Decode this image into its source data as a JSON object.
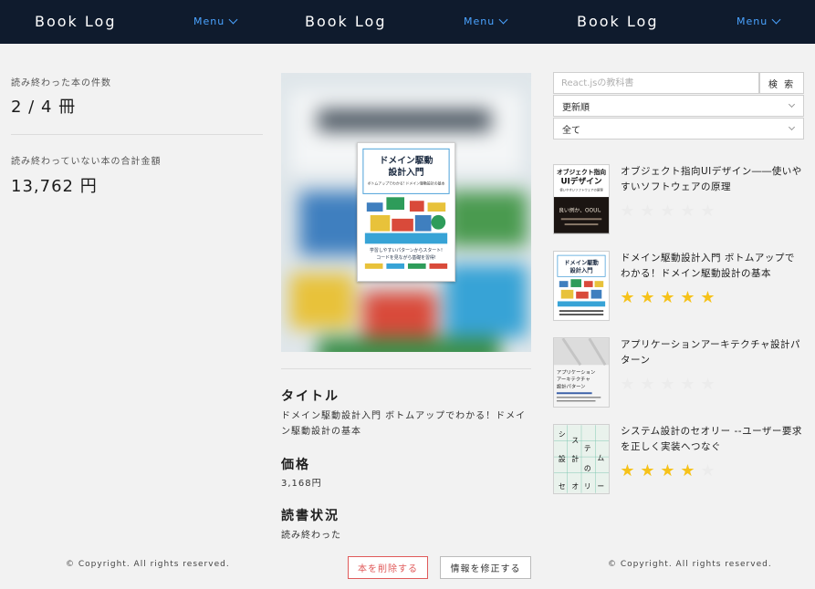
{
  "header": {
    "logos": [
      "Book Log",
      "Book Log",
      "Book Log"
    ],
    "menus": [
      "Menu",
      "Menu",
      "Menu"
    ]
  },
  "stats": {
    "read_count_label": "読み終わった本の件数",
    "read_count_value": "2 / 4 冊",
    "unread_total_label": "読み終わっていない本の合計金額",
    "unread_total_value": "13,762 円"
  },
  "detail": {
    "cover_text": {
      "title_line1": "ドメイン駆動",
      "title_line2": "設計入門",
      "subtitle": "ボトムアップでわかる! ドメイン駆動設計の基本",
      "blurb_line1": "学習しやすいパターンからスタート!",
      "blurb_line2": "コードを見ながら基礎を習得!"
    },
    "title_heading": "タイトル",
    "title_value": "ドメイン駆動設計入門 ボトムアップでわかる！ドメイン駆動設計の基本",
    "price_heading": "価格",
    "price_value": "3,168円",
    "status_heading": "読書状況",
    "status_value": "読み終わった",
    "delete_label": "本を削除する",
    "edit_label": "情報を修正する"
  },
  "footer": {
    "copyright_left": "© Copyright. All rights reserved.",
    "copyright_right": "© Copyright. All rights reserved."
  },
  "sidebar": {
    "search_placeholder": "React.jsの教科書",
    "search_button": "検 索",
    "sort_selected": "更新順",
    "filter_selected": "全て",
    "books": [
      {
        "title": "オブジェクト指向UIデザイン――使いやすいソフトウェアの原理",
        "rating": 0,
        "thumb": {
          "t1": "オブジェクト指向",
          "t2": "UIデザイン",
          "t3": "使いやすいソフトウェアの原理",
          "t4": "良い例か、OOUI。"
        }
      },
      {
        "title": "ドメイン駆動設計入門 ボトムアップでわかる！ドメイン駆動設計の基本",
        "rating": 5,
        "thumb": {
          "t1": "ドメイン駆動",
          "t2": "設計入門"
        }
      },
      {
        "title": "アプリケーションアーキテクチャ設計パターン",
        "rating": 0,
        "thumb": {
          "t1": "アプリケーション",
          "t2": "アーキテクチャ",
          "t3": "設計パターン"
        }
      },
      {
        "title": "システム設計のセオリー --ユーザー要求を正しく実装へつなぐ",
        "rating": 4,
        "thumb": {
          "c1": "シ",
          "c2": "ス",
          "c3": "テ",
          "c4": "ム",
          "c5": "設",
          "c6": "計",
          "c7": "の",
          "c8": "セ",
          "c9": "オ",
          "c10": "リ",
          "c11": "ー"
        }
      }
    ]
  },
  "colors": {
    "header_bg": "#0f1b2d",
    "menu_accent": "#4aa3ff",
    "star_on": "#f6c21a",
    "star_off": "#ececec",
    "delete_red": "#e05a5a"
  },
  "icons": {
    "menu": "chevron-down-icon",
    "select": "chevron-down-icon",
    "rating": "star-icon"
  }
}
